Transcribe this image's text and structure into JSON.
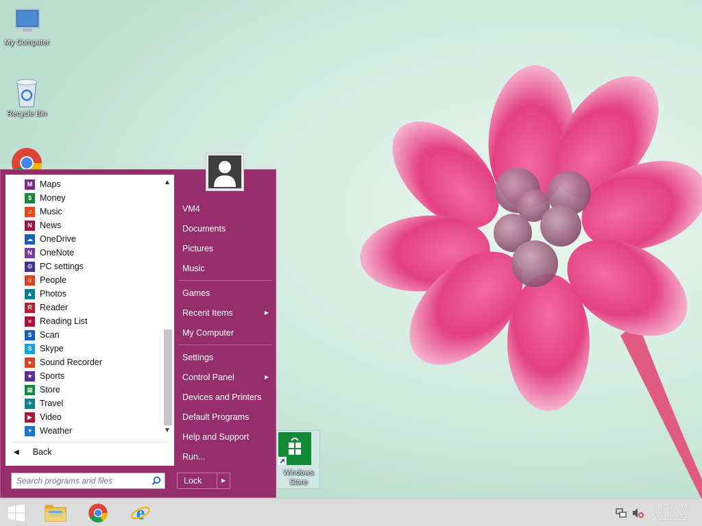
{
  "desktop_icons": [
    {
      "label": "My Computer",
      "icon": "monitor-icon"
    },
    {
      "label": "Recycle Bin",
      "icon": "recycle-bin-icon"
    },
    {
      "label": "",
      "icon": "chrome-icon"
    },
    {
      "label": "Windows Store",
      "icon": "windows-store-icon"
    }
  ],
  "start_menu": {
    "programs": [
      {
        "label": "Maps",
        "icon": "maps-icon",
        "color": "#7a2b8a"
      },
      {
        "label": "Money",
        "icon": "money-icon",
        "color": "#16863a"
      },
      {
        "label": "Music",
        "icon": "music-icon",
        "color": "#e04d1b"
      },
      {
        "label": "News",
        "icon": "news-icon",
        "color": "#a0133e"
      },
      {
        "label": "OneDrive",
        "icon": "onedrive-icon",
        "color": "#1b5fae"
      },
      {
        "label": "OneNote",
        "icon": "onenote-icon",
        "color": "#7b3b9c"
      },
      {
        "label": "PC settings",
        "icon": "pc-settings-icon",
        "color": "#4a2f8e"
      },
      {
        "label": "People",
        "icon": "people-icon",
        "color": "#d2461f"
      },
      {
        "label": "Photos",
        "icon": "photos-icon",
        "color": "#0b7d8f"
      },
      {
        "label": "Reader",
        "icon": "reader-icon",
        "color": "#b01e2f"
      },
      {
        "label": "Reading List",
        "icon": "reading-list-icon",
        "color": "#a5123a"
      },
      {
        "label": "Scan",
        "icon": "scan-icon",
        "color": "#1a5db3"
      },
      {
        "label": "Skype",
        "icon": "skype-icon",
        "color": "#1aa1dd"
      },
      {
        "label": "Sound Recorder",
        "icon": "sound-recorder-icon",
        "color": "#d24727"
      },
      {
        "label": "Sports",
        "icon": "sports-icon",
        "color": "#5c2d91"
      },
      {
        "label": "Store",
        "icon": "store-icon",
        "color": "#128a3a"
      },
      {
        "label": "Travel",
        "icon": "travel-icon",
        "color": "#0d7e8c"
      },
      {
        "label": "Video",
        "icon": "video-icon",
        "color": "#a41a3a"
      },
      {
        "label": "Weather",
        "icon": "weather-icon",
        "color": "#1d72c9"
      }
    ],
    "back_label": "Back",
    "search_placeholder": "Search programs and files",
    "right_items": [
      {
        "label": "VM4",
        "submenu": false
      },
      {
        "label": "Documents",
        "submenu": false
      },
      {
        "label": "Pictures",
        "submenu": false
      },
      {
        "label": "Music",
        "submenu": false
      },
      {
        "label": "Games",
        "submenu": false
      },
      {
        "label": "Recent Items",
        "submenu": true
      },
      {
        "label": "My Computer",
        "submenu": false
      },
      {
        "label": "Settings",
        "submenu": false
      },
      {
        "label": "Control Panel",
        "submenu": true
      },
      {
        "label": "Devices and Printers",
        "submenu": false
      },
      {
        "label": "Default Programs",
        "submenu": false
      },
      {
        "label": "Help and Support",
        "submenu": false
      },
      {
        "label": "Run...",
        "submenu": false
      }
    ],
    "lock_label": "Lock",
    "accent_color": "#962e6c"
  },
  "taskbar": {
    "pinned": [
      "windows-start-icon",
      "file-explorer-icon",
      "chrome-icon",
      "internet-explorer-icon"
    ],
    "tray_icons": [
      "network-icon",
      "volume-muted-icon"
    ],
    "time": "8:32 PM",
    "date": "5/21/2022"
  }
}
